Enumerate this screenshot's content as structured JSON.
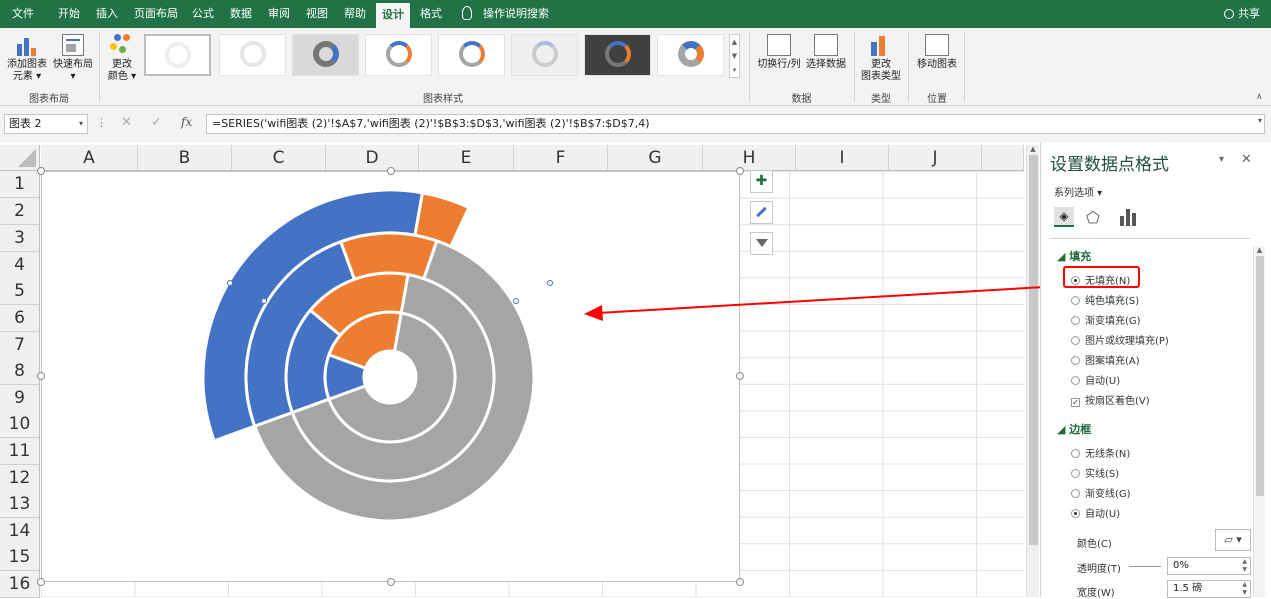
{
  "menu": {
    "tabs": [
      "文件",
      "开始",
      "插入",
      "页面布局",
      "公式",
      "数据",
      "审阅",
      "视图",
      "帮助",
      "设计",
      "格式"
    ],
    "tell_me": "操作说明搜索",
    "share": "共享"
  },
  "ribbon": {
    "add_element_1": "添加图表",
    "add_element_2": "元素 ▾",
    "quick_layout_1": "快速布局",
    "quick_layout_2": "▾",
    "change_color_1": "更改",
    "change_color_2": "颜色 ▾",
    "group_layout": "图表布局",
    "group_styles": "图表样式",
    "switch_row_col": "切换行/列",
    "select_data": "选择数据",
    "group_data": "数据",
    "change_type_1": "更改",
    "change_type_2": "图表类型",
    "group_type": "类型",
    "move_chart": "移动图表",
    "group_location": "位置"
  },
  "formula": {
    "name_box": "图表 2",
    "fx": "fx",
    "formula": "=SERIES('wifi图表 (2)'!$A$7,'wifi图表 (2)'!$B$3:$D$3,'wifi图表 (2)'!$B$7:$D$7,4)"
  },
  "sheet": {
    "columns": [
      "A",
      "B",
      "C",
      "D",
      "E",
      "F",
      "G",
      "H",
      "I",
      "J"
    ],
    "rows": [
      "1",
      "2",
      "3",
      "4",
      "5",
      "6",
      "7",
      "8",
      "9",
      "10",
      "11",
      "12",
      "13",
      "14",
      "15",
      "16"
    ]
  },
  "chart_data": {
    "type": "doughnut",
    "rings": [
      {
        "values": [
          1,
          2,
          6
        ],
        "colors": [
          "#4472c4",
          "#ed7d31",
          "#a5a5a5"
        ]
      },
      {
        "values": [
          2,
          2,
          8
        ],
        "colors": [
          "#4472c4",
          "#ed7d31",
          "#a5a5a5"
        ]
      },
      {
        "values": [
          3,
          1.3,
          7.7
        ],
        "colors": [
          "#4472c4",
          "#ed7d31",
          "#a5a5a5"
        ]
      },
      {
        "values": [
          4,
          0.5,
          7.5
        ],
        "colors": [
          "#4472c4",
          "#ed7d31",
          "#ffffff"
        ]
      }
    ]
  },
  "pane": {
    "title": "设置数据点格式",
    "series_options": "系列选项 ▾",
    "fill_section": "填充",
    "fill_options": [
      "无填充(N)",
      "纯色填充(S)",
      "渐变填充(G)",
      "图片或纹理填充(P)",
      "图案填充(A)",
      "自动(U)"
    ],
    "invert_label": "按扇区着色(V)",
    "border_section": "边框",
    "border_options": [
      "无线条(N)",
      "实线(S)",
      "渐变线(G)",
      "自动(U)"
    ],
    "color_label": "颜色(C)",
    "transparency_label": "透明度(T)",
    "transparency_value": "0%",
    "width_label": "宽度(W)",
    "width_value": "1.5 磅"
  },
  "colors": {
    "excel_green": "#217346",
    "highlight_red": "#ff0000"
  }
}
